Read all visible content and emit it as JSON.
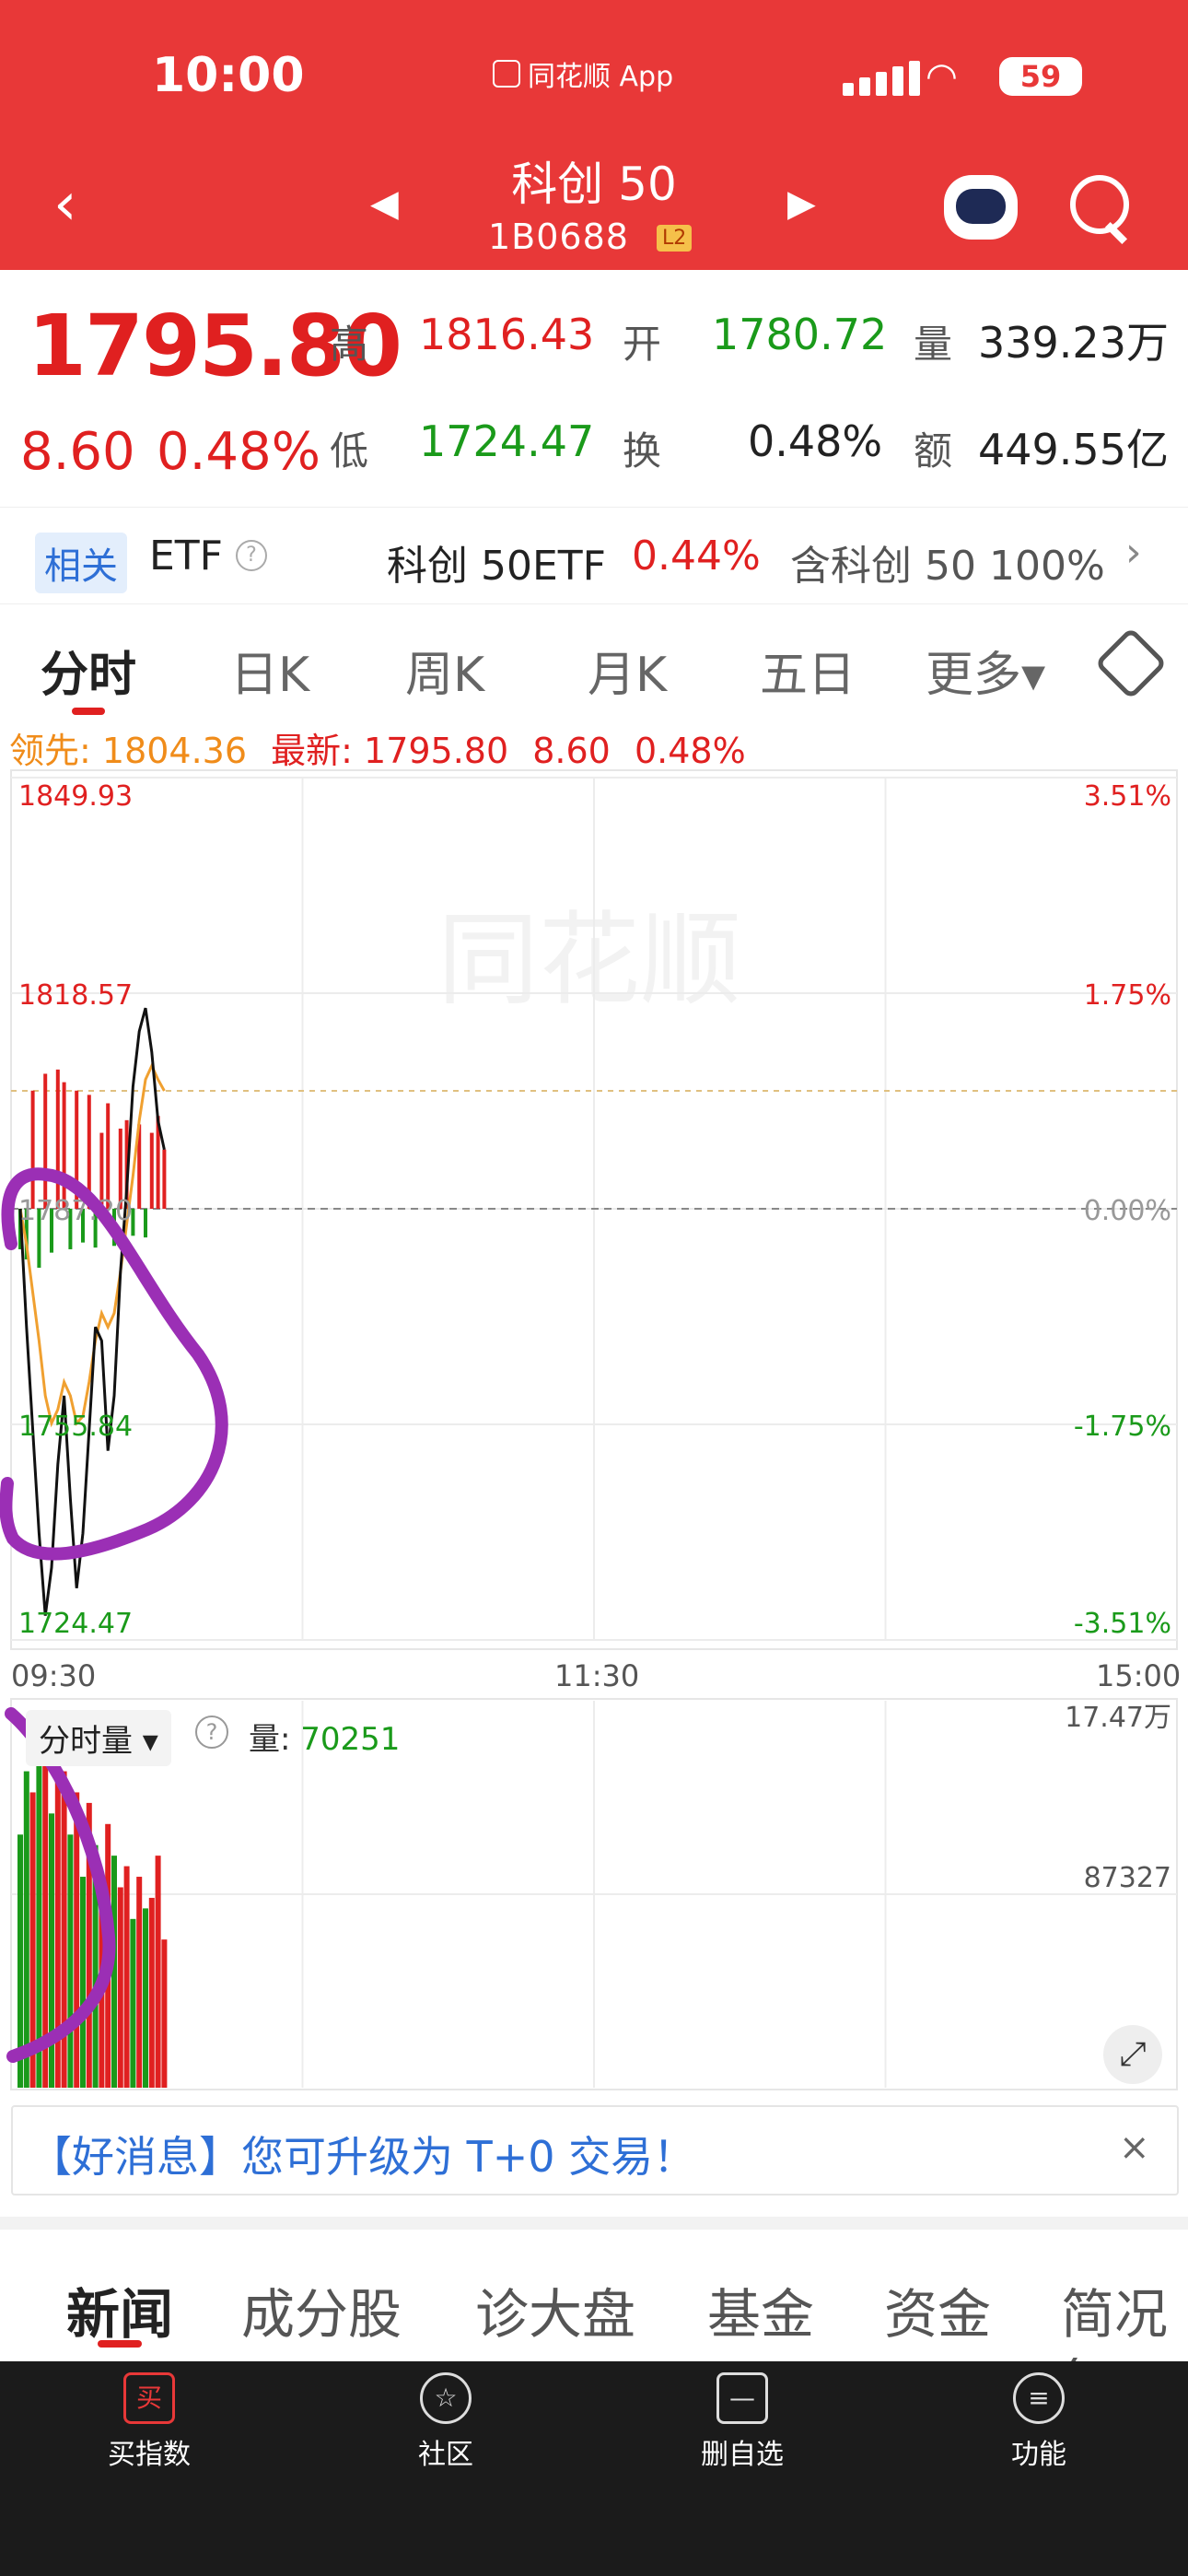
{
  "status_bar": {
    "time": "10:00",
    "app_name": "同花顺 App",
    "battery": "59"
  },
  "header": {
    "title": "科创 50",
    "code": "1B0688",
    "level_badge": "L2"
  },
  "quote": {
    "price": "1795.80",
    "change": "8.60",
    "change_pct": "0.48%",
    "high_label": "高",
    "high": "1816.43",
    "open_label": "开",
    "open": "1780.72",
    "volume_label": "量",
    "volume": "339.23万",
    "low_label": "低",
    "low": "1724.47",
    "turnover_label": "换",
    "turnover": "0.48%",
    "amount_label": "额",
    "amount": "449.55亿"
  },
  "etf": {
    "tag": "相关",
    "label": "ETF",
    "name": "科创 50ETF",
    "pct": "0.44%",
    "contain": "含科创 50 100%"
  },
  "tabs": [
    "分时",
    "日K",
    "周K",
    "月K",
    "五日",
    "更多▾"
  ],
  "chart_info": {
    "lead_label": "领先: ",
    "lead": "1804.36",
    "latest_label": "最新: ",
    "latest": "1795.80",
    "latest_change": "8.60",
    "latest_pct": "0.48%"
  },
  "chart_data": {
    "type": "line",
    "y_left_ticks": [
      "1849.93",
      "1818.57",
      "1787.20",
      "1755.84",
      "1724.47"
    ],
    "y_right_ticks": [
      "3.51%",
      "1.75%",
      "0.00%",
      "-1.75%",
      "-3.51%"
    ],
    "x_ticks": [
      "09:30",
      "11:30",
      "15:00"
    ],
    "ylim": [
      1724.47,
      1849.93
    ],
    "prev_close": 1787.2,
    "price": [
      1787.2,
      1770,
      1755,
      1740,
      1728,
      1735,
      1750,
      1760,
      1745,
      1732,
      1740,
      1755,
      1770,
      1768,
      1752,
      1760,
      1778,
      1790,
      1805,
      1813,
      1816.4,
      1810,
      1800,
      1795.8
    ],
    "average": [
      1787.2,
      1782,
      1775,
      1768,
      1760,
      1756,
      1758,
      1762,
      1760,
      1756,
      1757,
      1762,
      1768,
      1772,
      1770,
      1772,
      1778,
      1785,
      1792,
      1800,
      1806,
      1808,
      1806,
      1804.36
    ],
    "volume_panel": {
      "label": "分时量",
      "volume_label": "量: ",
      "volume_value": "70251",
      "ticks": [
        "17.47万",
        "87327"
      ],
      "ylim": [
        0,
        174700
      ],
      "bars": [
        120000,
        150000,
        140000,
        174700,
        160000,
        130000,
        165000,
        150000,
        120000,
        140000,
        100000,
        135000,
        115000,
        90000,
        125000,
        110000,
        95000,
        105000,
        80000,
        100000,
        85000,
        90000,
        110000,
        70251
      ],
      "bar_colors": [
        "green",
        "green",
        "red",
        "green",
        "red",
        "green",
        "red",
        "red",
        "green",
        "red",
        "green",
        "red",
        "green",
        "red",
        "red",
        "green",
        "red",
        "red",
        "green",
        "red",
        "green",
        "red",
        "red",
        "red"
      ]
    }
  },
  "watermark": "同花顺",
  "promo": {
    "text": "【好消息】您可升级为 T+0 交易！",
    "close": "×"
  },
  "bottom_tabs": [
    "新闻",
    "成分股",
    "诊大盘",
    "基金",
    "资金",
    "简况("
  ],
  "nav": [
    {
      "icon": "买",
      "label": "买指数"
    },
    {
      "icon": "☆",
      "label": "社区"
    },
    {
      "icon": "—",
      "label": "删自选"
    },
    {
      "icon": "≡",
      "label": "功能"
    }
  ],
  "colors": {
    "brand": "#e83838",
    "up": "#e02020",
    "down": "#1a9a1a",
    "avg_line": "#f0a030",
    "annotation": "#9b2fb5"
  }
}
